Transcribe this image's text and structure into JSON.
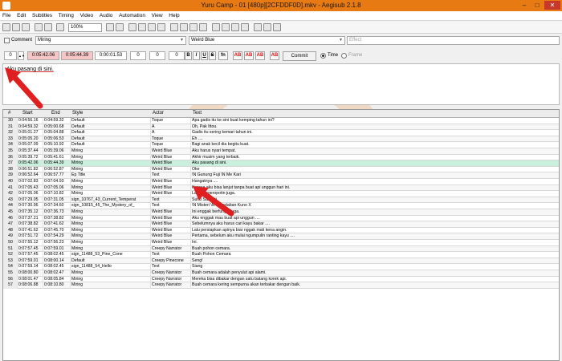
{
  "window": {
    "title": "Yuru Camp - 01 [480p][2CFDDF0D].mkv - Aegisub 2.1.8",
    "minimize": "–",
    "maximize": "□",
    "close": "✕"
  },
  "menu": [
    "File",
    "Edit",
    "Subtitles",
    "Timing",
    "Video",
    "Audio",
    "Automation",
    "View",
    "Help"
  ],
  "toolbar": {
    "zoom_value": "100%",
    "icons": [
      "new-icon",
      "open-icon",
      "save-icon",
      "video-open-icon",
      "video-close-icon",
      "jump-icon",
      "zoom-icon",
      "fullscreen-icon",
      "style-icon",
      "properties-icon",
      "attachments-icon",
      "fonts-icon",
      "automation-icon",
      "translation-icon",
      "spellcheck-icon",
      "timing-icon",
      "shift-icon",
      "sort-icon",
      "styling-icon",
      "kanji-icon",
      "resample-icon",
      "options-icon",
      "help-icon"
    ]
  },
  "editor": {
    "comment_label": "Comment",
    "style": "Miring",
    "actor": "Weird Blue",
    "effect_placeholder": "Effect",
    "layer": "0",
    "start": "0:05:42.06",
    "end": "0:05:44.39",
    "duration": "0:00:01.53",
    "margin_l": "0",
    "margin_r": "0",
    "margin_v": "0",
    "fmt_buttons": [
      "B",
      "I",
      "U",
      "S",
      "fn",
      "AB",
      "AB",
      "AB",
      "AB"
    ],
    "commit": "Commit",
    "time_label": "Time",
    "frame_label": "Frame",
    "text": "Aku pasang di sini."
  },
  "grid": {
    "headers": [
      "#",
      "Start",
      "End",
      "Style",
      "Actor",
      "Text"
    ],
    "rows": [
      {
        "num": "30",
        "start": "0:04:56.16",
        "end": "0:04:59.32",
        "style": "Default",
        "actor": "Toque",
        "text": "Apa gadis itu ke sini buat kemping tahun ini?"
      },
      {
        "num": "31",
        "start": "0:04:59.32",
        "end": "0:05:00.68",
        "style": "Default",
        "actor": "A",
        "text": "Oh, Pak Ittou."
      },
      {
        "num": "32",
        "start": "0:05:01.27",
        "end": "0:05:04.88",
        "style": "Default",
        "actor": "A",
        "text": "Gadis itu sering kemari tahun ini."
      },
      {
        "num": "33",
        "start": "0:05:05.20",
        "end": "0:05:06.53",
        "style": "Default",
        "actor": "Toque",
        "text": "Eh ...."
      },
      {
        "num": "34",
        "start": "0:05:07.09",
        "end": "0:05:10.92",
        "style": "Default",
        "actor": "Toque",
        "text": "Bagi anak kecil dia begitu kuat."
      },
      {
        "num": "35",
        "start": "0:05:37.44",
        "end": "0:05:39.06",
        "style": "Miring",
        "actor": "Weird Blue",
        "text": "Aku harus nyari tempat."
      },
      {
        "num": "36",
        "start": "0:05:39.72",
        "end": "0:05:41.61",
        "style": "Miring",
        "actor": "Weird Blue",
        "text": "Akhir musim yang terbaik."
      },
      {
        "num": "37",
        "start": "0:05:42.06",
        "end": "0:05:44.39",
        "style": "Miring",
        "actor": "Weird Blue",
        "text": "Aku pasang di sini.",
        "selected": true
      },
      {
        "num": "38",
        "start": "0:06:51.82",
        "end": "0:06:52.87",
        "style": "Miring",
        "actor": "Weird Blue",
        "text": "Oke"
      },
      {
        "num": "39",
        "start": "0:06:52.64",
        "end": "0:06:57.77",
        "style": "Ep Title",
        "actor": "Text",
        "text": "\\N Gunung Fuji \\N Me Kari"
      },
      {
        "num": "40",
        "start": "0:07:02.83",
        "end": "0:07:04.93",
        "style": "Miring",
        "actor": "Weird Blue",
        "text": "Hangatnya ...."
      },
      {
        "num": "41",
        "start": "0:07:05.43",
        "end": "0:07:05.06",
        "style": "Miring",
        "actor": "Weird Blue",
        "text": "Kurasa aku bisa lanjut tanpa buat api unggun hari ini."
      },
      {
        "num": "42",
        "start": "0:07:05.06",
        "end": "0:07:10.82",
        "style": "Miring",
        "actor": "Weird Blue",
        "text": "Lagian ngeropotin juga."
      },
      {
        "num": "43",
        "start": "0:07:29.05",
        "end": "0:07:31.05",
        "style": "sign_10767_43_Current_Temperat",
        "actor": "Text",
        "text": "Suhu Saat Ini"
      },
      {
        "num": "44",
        "start": "0:07:30.96",
        "end": "0:07:34.60",
        "style": "sign_10815_45_The_Mystery_of_",
        "actor": "Text",
        "text": "\\N Misteri \\N Peradaban Kuno X"
      },
      {
        "num": "45",
        "start": "0:07:35.12",
        "end": "0:07:36.73",
        "style": "Miring",
        "actor": "Weird Blue",
        "text": "Ini enggak berfungsi juga."
      },
      {
        "num": "46",
        "start": "0:07:37.21",
        "end": "0:07:38.82",
        "style": "Miring",
        "actor": "Weird Blue",
        "text": "Aku enggak mau buat api unggun ...."
      },
      {
        "num": "47",
        "start": "0:07:38.82",
        "end": "0:07:41.62",
        "style": "Miring",
        "actor": "Weird Blue",
        "text": "Sebelumnya aku harus cari kayu bakar ...."
      },
      {
        "num": "48",
        "start": "0:07:41.62",
        "end": "0:07:45.70",
        "style": "Miring",
        "actor": "Weird Blue",
        "text": "Lalu persiapkan apinya biar nggak mati kena angin."
      },
      {
        "num": "49",
        "start": "0:07:51.72",
        "end": "0:07:54.29",
        "style": "Miring",
        "actor": "Weird Blue",
        "text": "Pertama, sebelum aku mulai ngumpulin ranting kayu ...."
      },
      {
        "num": "50",
        "start": "0:07:55.12",
        "end": "0:07:56.23",
        "style": "Miring",
        "actor": "Weird Blue",
        "text": "Ini."
      },
      {
        "num": "51",
        "start": "0:07:57.45",
        "end": "0:07:59.01",
        "style": "Miring",
        "actor": "Creepy Narrator",
        "text": "Buah pohon cemara."
      },
      {
        "num": "52",
        "start": "0:07:57.45",
        "end": "0:08:02.45",
        "style": "sign_11488_53_Pine_Cone",
        "actor": "Text",
        "text": "Buah Pohon Cemara"
      },
      {
        "num": "53",
        "start": "0:07:59.01",
        "end": "0:08:00.14",
        "style": "Default",
        "actor": "Creepy Pinecone",
        "text": "Seng!"
      },
      {
        "num": "54",
        "start": "0:07:59.14",
        "end": "0:08:02.45",
        "style": "sign_11488_54_Hello",
        "actor": "Text",
        "text": "Siang"
      },
      {
        "num": "55",
        "start": "0:08:00.80",
        "end": "0:08:02.47",
        "style": "Miring",
        "actor": "Creepy Narrator",
        "text": "Buah cemara adalah penyulut api alami."
      },
      {
        "num": "56",
        "start": "0:08:01.47",
        "end": "0:08:05.84",
        "style": "Miring",
        "actor": "Creepy Narrator",
        "text": "Mereka bisa dibakar dengan satu batang korek api."
      },
      {
        "num": "57",
        "start": "0:08:06.88",
        "end": "0:08:10.80",
        "style": "Miring",
        "actor": "Creepy Narrator",
        "text": "Buah cemara kering sempurna akan terbakar dengan baik."
      }
    ]
  },
  "overlay": {
    "watermark_text": "Otimaru",
    "accent_color": "#f28a2e",
    "arrow_color": "#e02020"
  }
}
